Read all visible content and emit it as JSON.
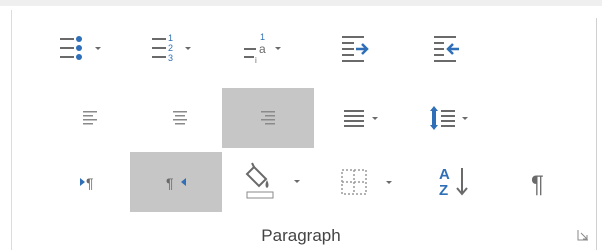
{
  "group": {
    "label": "Paragraph"
  },
  "colors": {
    "icon_dark": "#5f5f5f",
    "icon_light": "#9a9a9a",
    "accent_blue": "#2f6fb7",
    "pressed_bg": "#c6c6c6"
  },
  "toolbar": {
    "row1": [
      "bullets",
      "numbering",
      "multilevel-list",
      "decrease-indent",
      "increase-indent"
    ],
    "row2": [
      "align-left",
      "center",
      "align-right",
      "justify",
      "line-spacing"
    ],
    "row3": [
      "left-to-right",
      "right-to-left",
      "shading",
      "borders",
      "sort",
      "show-hide-marks"
    ],
    "pressed": [
      "align-right",
      "right-to-left"
    ],
    "numbering_glyphs": [
      "1",
      "2",
      "3"
    ],
    "multilevel_glyphs": [
      "1",
      "a",
      "i"
    ],
    "sort_glyphs": [
      "A",
      "Z"
    ],
    "pilcrow": "¶"
  }
}
